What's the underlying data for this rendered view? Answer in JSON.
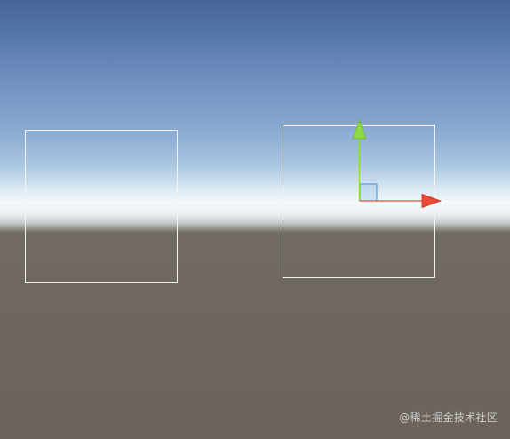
{
  "scene": {
    "sky_top_color": "#46659a",
    "horizon_color": "#f4f8fb",
    "ground_color": "#6d665e",
    "outline_color": "#f2f2f2"
  },
  "objects": [
    {
      "name": "left-quad",
      "selected": false
    },
    {
      "name": "right-quad",
      "selected": true
    }
  ],
  "gizmo": {
    "type": "move",
    "x_axis_color": "#ea4a35",
    "y_axis_color": "#8cd847",
    "z_plane_color": "#4a8fd6",
    "x_axis_icon": "arrow-right-icon",
    "y_axis_icon": "arrow-up-icon"
  },
  "watermark": {
    "text": "@稀土掘金技术社区"
  }
}
